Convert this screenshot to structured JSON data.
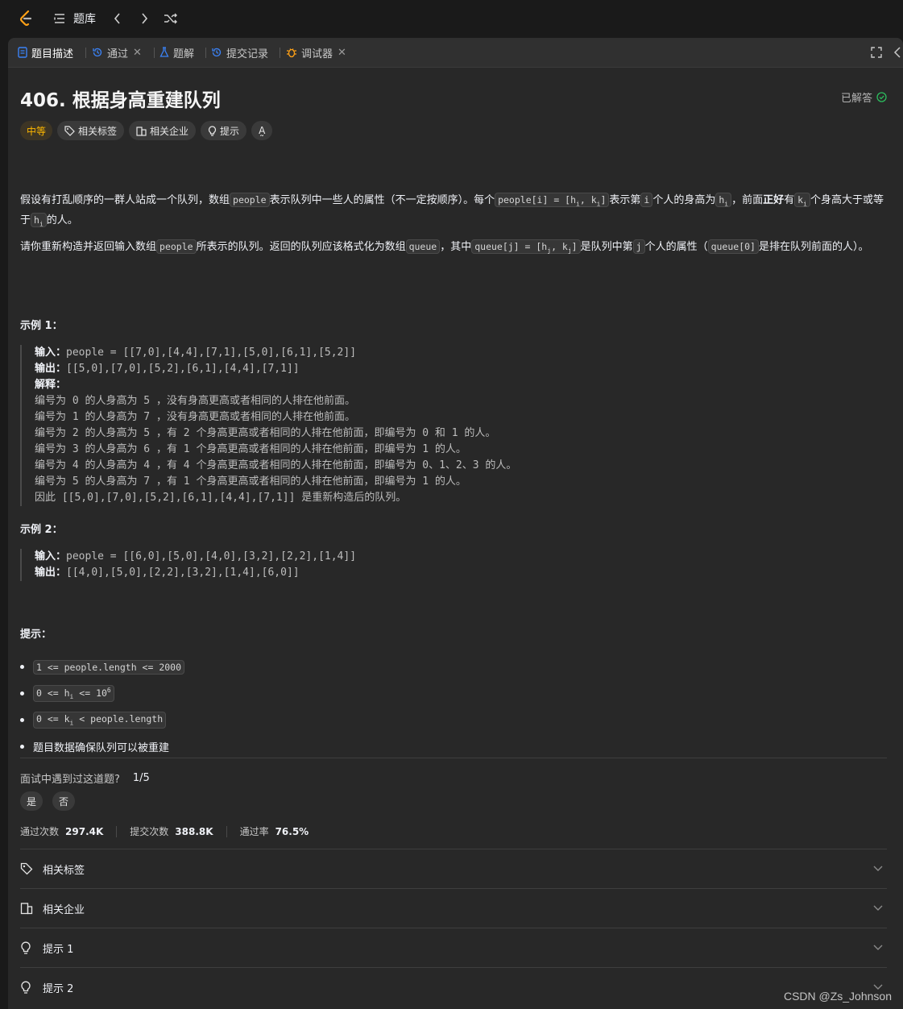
{
  "topbar": {
    "problemset_label": "题库"
  },
  "tabs": [
    {
      "label": "题目描述"
    },
    {
      "label": "通过"
    },
    {
      "label": "题解"
    },
    {
      "label": "提交记录"
    },
    {
      "label": "调试器"
    }
  ],
  "problem": {
    "title": "406. 根据身高重建队列",
    "status": "已解答",
    "difficulty": "中等",
    "tag_labels": {
      "topics": "相关标签",
      "companies": "相关企业",
      "hints": "提示",
      "translate": "A̰"
    }
  },
  "description": {
    "p1_a": "假设有打乱顺序的一群人站成一个队列，数组",
    "p1_code1": "people",
    "p1_b": "表示队列中一些人的属性（不一定按顺序）。每个",
    "p1_code2": "people[i] = [h",
    "p1_c": "表示第",
    "p1_code3": "i",
    "p1_d": "个人的身高为",
    "p1_e": "，前面",
    "p1_bold": "正好",
    "p1_f": "有",
    "p1_g": "个身高大于或等于",
    "p1_h": "的人。",
    "p2_a": "请你重新构造并返回输入数组",
    "p2_code1": "people",
    "p2_b": "所表示的队列。返回的队列应该格式化为数组",
    "p2_code2": "queue",
    "p2_c": "，其中",
    "p2_code3": "queue[j] = [h",
    "p2_d": "是队列中第",
    "p2_code4": "j",
    "p2_e": "个人的属性（",
    "p2_code5": "queue[0]",
    "p2_f": "是排在队列前面的人）。"
  },
  "examples": [
    {
      "heading": "示例 1：",
      "input_label": "输入：",
      "input": "people = [[7,0],[4,4],[7,1],[5,0],[6,1],[5,2]]",
      "output_label": "输出：",
      "output": "[[5,0],[7,0],[5,2],[6,1],[4,4],[7,1]]",
      "explain_label": "解释：",
      "explain": [
        "编号为 0 的人身高为 5 ，没有身高更高或者相同的人排在他前面。",
        "编号为 1 的人身高为 7 ，没有身高更高或者相同的人排在他前面。",
        "编号为 2 的人身高为 5 ，有 2 个身高更高或者相同的人排在他前面，即编号为 0 和 1 的人。",
        "编号为 3 的人身高为 6 ，有 1 个身高更高或者相同的人排在他前面，即编号为 1 的人。",
        "编号为 4 的人身高为 4 ，有 4 个身高更高或者相同的人排在他前面，即编号为 0、1、2、3 的人。",
        "编号为 5 的人身高为 7 ，有 1 个身高更高或者相同的人排在他前面，即编号为 1 的人。",
        "因此 [[5,0],[7,0],[5,2],[6,1],[4,4],[7,1]] 是重新构造后的队列。"
      ]
    },
    {
      "heading": "示例 2：",
      "input_label": "输入：",
      "input": "people = [[6,0],[5,0],[4,0],[3,2],[2,2],[1,4]]",
      "output_label": "输出：",
      "output": "[[4,0],[5,0],[2,2],[3,2],[1,4],[6,0]]"
    }
  ],
  "constraints": {
    "heading": "提示：",
    "items": [
      "1 <= people.length <= 2000",
      "0 <= h",
      "0 <= k",
      "题目数据确保队列可以被重建"
    ],
    "c2_tail": " <= 10",
    "c3_tail": " < people.length"
  },
  "interview": {
    "question": "面试中遇到过这道题?",
    "count": "1/5",
    "yes": "是",
    "no": "否"
  },
  "stats": {
    "accepted_label": "通过次数",
    "accepted": "297.4K",
    "submissions_label": "提交次数",
    "submissions": "388.8K",
    "rate_label": "通过率",
    "rate": "76.5%"
  },
  "accordion": [
    {
      "label": "相关标签"
    },
    {
      "label": "相关企业"
    },
    {
      "label": "提示 1"
    },
    {
      "label": "提示 2"
    }
  ],
  "watermark": "CSDN @Zs_Johnson"
}
